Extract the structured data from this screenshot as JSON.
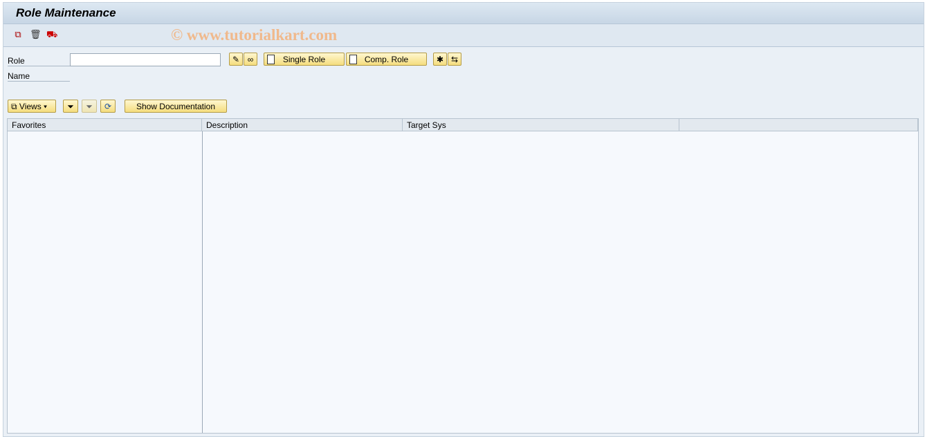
{
  "title": "Role Maintenance",
  "watermark": "© www.tutorialkart.com",
  "toolbar": {
    "icons": [
      "copy-icon",
      "delete-icon",
      "transport-icon"
    ]
  },
  "form": {
    "role_label": "Role",
    "role_value": "",
    "name_label": "Name"
  },
  "buttons": {
    "single_role": "Single Role",
    "comp_role": "Comp. Role",
    "views": "Views",
    "show_doc": "Show Documentation"
  },
  "table": {
    "columns": [
      "Favorites",
      "Description",
      "Target Sys"
    ]
  }
}
